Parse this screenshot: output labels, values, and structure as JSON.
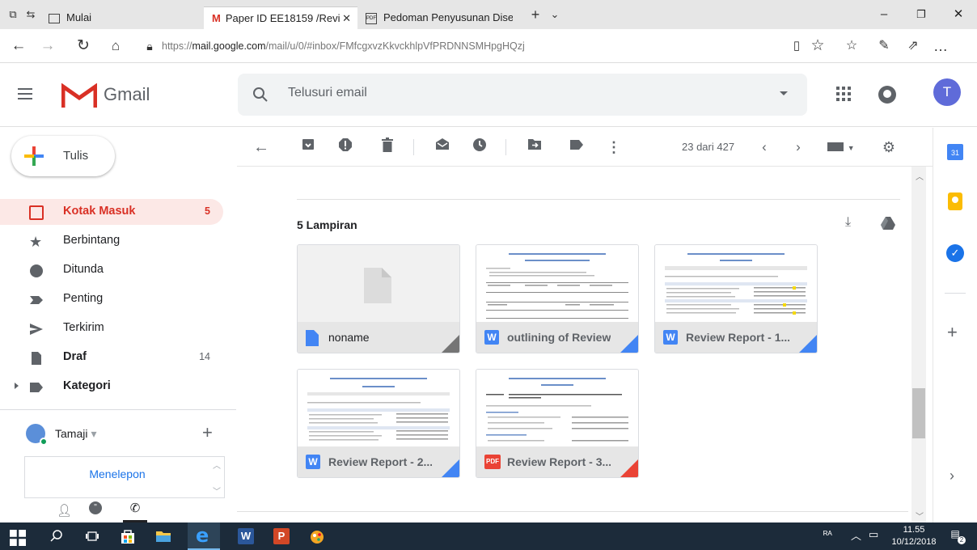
{
  "browser": {
    "tabs": [
      {
        "label": "Mulai"
      },
      {
        "label": "Paper ID EE18159 /Revi"
      },
      {
        "label": "Pedoman Penyusunan Diser"
      }
    ],
    "url_prefix": "https://",
    "url_host": "mail.google.com",
    "url_path": "/mail/u/0/#inbox/FMfcgxvzKkvckhlpVfPRDNNSMHpgHQzj"
  },
  "gmail": {
    "logo_text": "Gmail",
    "search_placeholder": "Telusuri email",
    "avatar_letter": "T",
    "compose_label": "Tulis",
    "nav": [
      {
        "label": "Kotak Masuk",
        "count": "5",
        "icon": "inbox-icon",
        "active": true
      },
      {
        "label": "Berbintang",
        "count": "",
        "icon": "star-icon"
      },
      {
        "label": "Ditunda",
        "count": "",
        "icon": "clock-icon"
      },
      {
        "label": "Penting",
        "count": "",
        "icon": "important-icon"
      },
      {
        "label": "Terkirim",
        "count": "",
        "icon": "send-icon"
      },
      {
        "label": "Draf",
        "count": "14",
        "icon": "draft-icon"
      },
      {
        "label": "Kategori",
        "count": "",
        "icon": "label-icon"
      }
    ],
    "hangouts_user": "Tamaji",
    "hangouts_call": "Menelepon",
    "pagination": "23 dari 427"
  },
  "attachments": {
    "heading": "5 Lampiran",
    "files": [
      {
        "name": "noname",
        "type": "doc",
        "icon_letter": "",
        "color": "#4285f4",
        "corner": "#757575"
      },
      {
        "name": "outlining of Review...",
        "type": "word",
        "icon_letter": "W",
        "color": "#4285f4",
        "corner": "#4285f4"
      },
      {
        "name": "Review Report - 1....",
        "type": "word",
        "icon_letter": "W",
        "color": "#4285f4",
        "corner": "#4285f4"
      },
      {
        "name": "Review Report - 2....",
        "type": "word",
        "icon_letter": "W",
        "color": "#4285f4",
        "corner": "#4285f4"
      },
      {
        "name": "Review Report - 3....",
        "type": "pdf",
        "icon_letter": "PDF",
        "color": "#ea4335",
        "corner": "#ea4335"
      }
    ]
  },
  "taskbar": {
    "time": "11.55",
    "date": "10/12/2018",
    "notif_count": "2"
  },
  "colors": {
    "accent_red": "#d93025",
    "active_nav_bg": "#fce8e6",
    "avatar_bg": "#5f6bd9"
  }
}
